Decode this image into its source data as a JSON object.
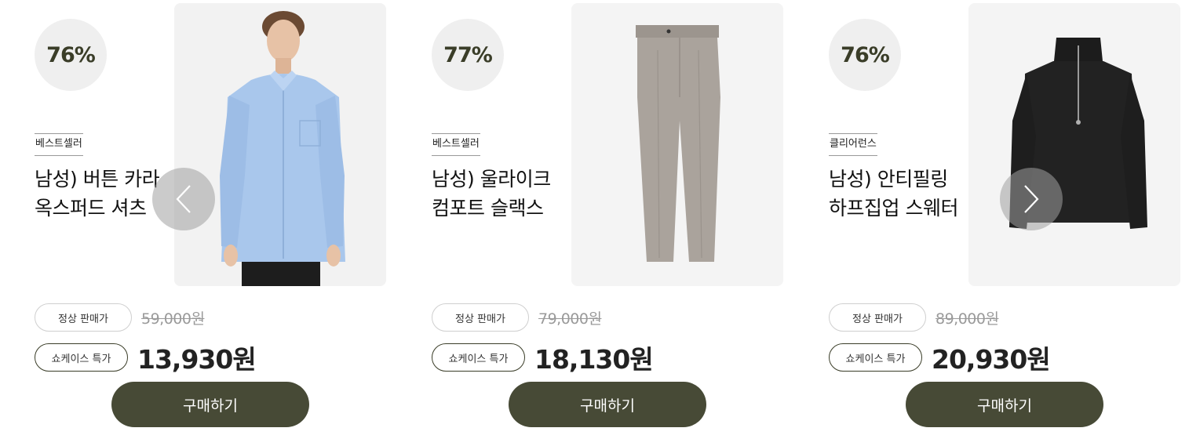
{
  "colors": {
    "accent": "#474a36",
    "discount_text": "#3a3d28",
    "circle_bg": "#efefef",
    "image_bg": "#f4f4f4"
  },
  "carousel": {
    "prev_icon": "chevron-left-icon",
    "next_icon": "chevron-right-icon"
  },
  "products": [
    {
      "discount": "76%",
      "badge": "베스트셀러",
      "name_line1": "남성) 버튼 카라",
      "name_line2": "옥스퍼드 셔츠",
      "regular_label": "정상 판매가",
      "regular_price": "59,000원",
      "special_label": "쇼케이스 특가",
      "special_price": "13,930원",
      "buy_label": "구매하기",
      "image": "blue oxford shirt model"
    },
    {
      "discount": "77%",
      "badge": "베스트셀러",
      "name_line1": "남성) 울라이크",
      "name_line2": "컴포트 슬랙스",
      "regular_label": "정상 판매가",
      "regular_price": "79,000원",
      "special_label": "쇼케이스 특가",
      "special_price": "18,130원",
      "buy_label": "구매하기",
      "image": "gray slacks"
    },
    {
      "discount": "76%",
      "badge": "클리어런스",
      "name_line1": "남성) 안티필링",
      "name_line2": "하프집업 스웨터",
      "regular_label": "정상 판매가",
      "regular_price": "89,000원",
      "special_label": "쇼케이스 특가",
      "special_price": "20,930원",
      "buy_label": "구매하기",
      "image": "black half-zip sweater"
    }
  ]
}
